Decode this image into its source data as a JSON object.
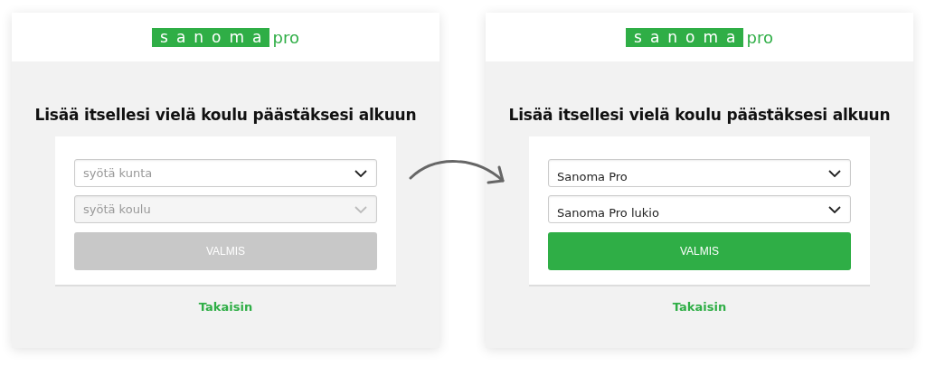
{
  "screens": [
    {
      "logo": {
        "brand": "sanoma",
        "suffix": "pro"
      },
      "heading": "Lisää itsellesi vielä koulu päästäksesi alkuun",
      "fields": [
        {
          "placeholder": "syötä kunta",
          "disabled": false
        },
        {
          "placeholder": "syötä koulu",
          "disabled": true
        }
      ],
      "button": {
        "label": "VALMIS",
        "disabled": true
      },
      "back_link": "Takaisin"
    },
    {
      "logo": {
        "brand": "sanoma",
        "suffix": "pro"
      },
      "heading": "Lisää itsellesi vielä koulu päästäksesi alkuun",
      "fields": [
        {
          "value": "Sanoma Pro",
          "disabled": false
        },
        {
          "value": "Sanoma Pro lukio",
          "disabled": false
        }
      ],
      "button": {
        "label": "VALMIS",
        "disabled": false
      },
      "back_link": "Takaisin"
    }
  ]
}
